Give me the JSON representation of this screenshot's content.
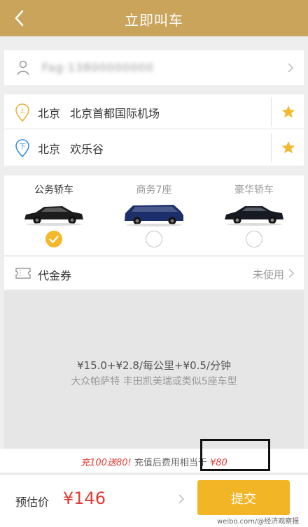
{
  "header": {
    "title": "立即叫车",
    "back_icon": "back-arrow-icon"
  },
  "passenger": {
    "name": "Fag·13800000000",
    "icon": "person-icon"
  },
  "route": {
    "start": {
      "city": "北京",
      "place": "北京首都国际机场",
      "badge": "上",
      "icon": "start-pin-icon"
    },
    "end": {
      "city": "北京",
      "place": "欢乐谷",
      "badge": "下",
      "icon": "end-pin-icon"
    }
  },
  "car_types": [
    {
      "label": "公务轿车",
      "selected": true
    },
    {
      "label": "商务7座",
      "selected": false
    },
    {
      "label": "豪华轿车",
      "selected": false
    }
  ],
  "coupon": {
    "label": "代金券",
    "status": "未使用",
    "icon": "ticket-icon"
  },
  "pricing": {
    "rule": "¥15.0+¥2.8/每公里+¥0.5/分钟",
    "models": "大众帕萨特 丰田凯美瑞或类似5座车型"
  },
  "promo": {
    "highlight": "充100送80!",
    "text": "充值后费用相当于",
    "amount": "¥80"
  },
  "footer": {
    "estimate_label": "预估价",
    "estimate_value": "¥146",
    "submit_label": "提交",
    "watermark": "weibo.com/@经济观察报"
  },
  "colors": {
    "brand_gold": "#c9a45a",
    "accent_yellow": "#f3b82b",
    "price_red": "#e23b33"
  }
}
